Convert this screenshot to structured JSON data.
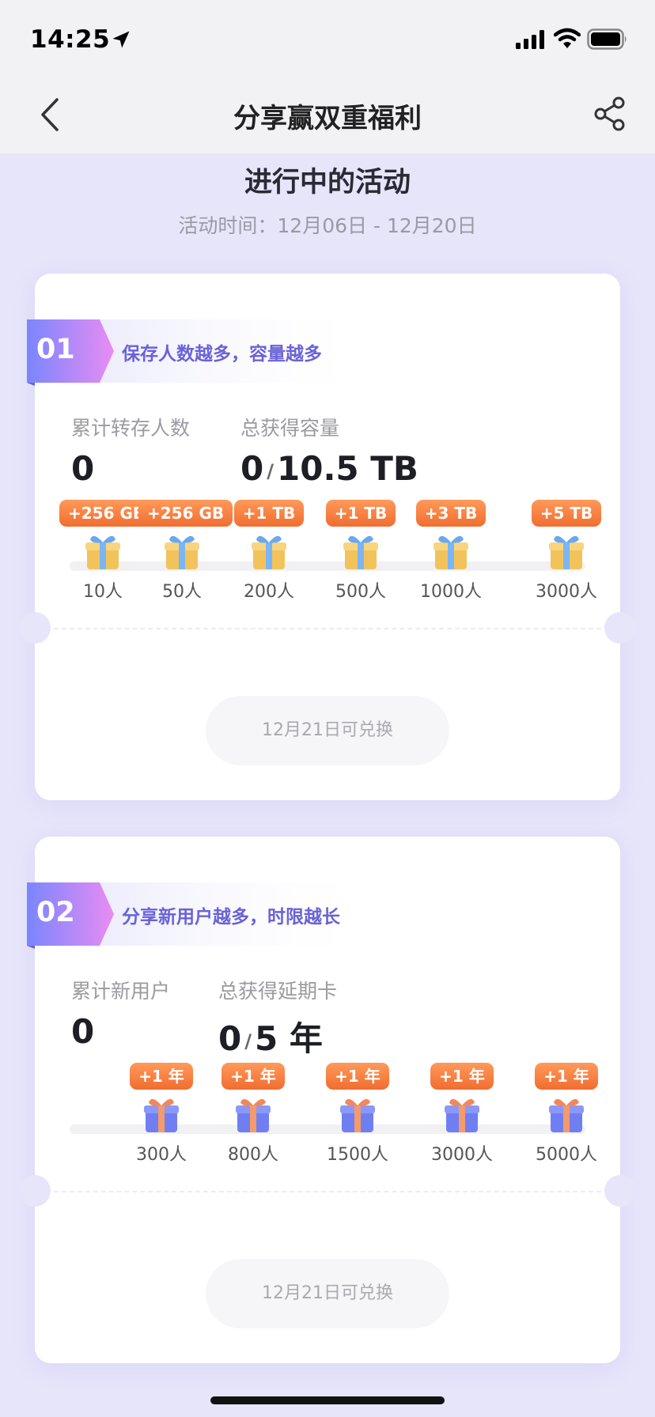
{
  "status_bar": {
    "time": "14:25"
  },
  "nav": {
    "title": "分享赢双重福利"
  },
  "section": {
    "title": "进行中的活动",
    "time_label": "活动时间：12月06日 - 12月20日"
  },
  "activities": [
    {
      "number": "01",
      "headline": "保存人数越多，容量越多",
      "stat_left_label": "累计转存人数",
      "stat_left_value": "0",
      "stat_right_label": "总获得容量",
      "stat_right_value": "0",
      "stat_right_total": "10.5 TB",
      "milestones": [
        {
          "reward": "+256 GB",
          "threshold": "10人"
        },
        {
          "reward": "+256 GB",
          "threshold": "50人"
        },
        {
          "reward": "+1 TB",
          "threshold": "200人"
        },
        {
          "reward": "+1 TB",
          "threshold": "500人"
        },
        {
          "reward": "+3 TB",
          "threshold": "1000人"
        },
        {
          "reward": "+5 TB",
          "threshold": "3000人"
        }
      ],
      "redeem_label": "12月21日可兑换"
    },
    {
      "number": "02",
      "headline": "分享新用户越多，时限越长",
      "stat_left_label": "累计新用户",
      "stat_left_value": "0",
      "stat_right_label": "总获得延期卡",
      "stat_right_value": "0",
      "stat_right_total": "5 年",
      "milestones": [
        {
          "reward": "+1 年",
          "threshold": "300人"
        },
        {
          "reward": "+1 年",
          "threshold": "800人"
        },
        {
          "reward": "+1 年",
          "threshold": "1500人"
        },
        {
          "reward": "+1 年",
          "threshold": "3000人"
        },
        {
          "reward": "+1 年",
          "threshold": "5000人"
        }
      ],
      "redeem_label": "12月21日可兑换"
    }
  ],
  "icons": {
    "location": "location-arrow-icon",
    "signal": "cellular-signal-icon",
    "wifi": "wifi-icon",
    "battery": "battery-icon",
    "back": "chevron-left-icon",
    "share": "share-icon",
    "gift_box_1": "gift-box-yellow-icon",
    "gift_box_2": "gift-box-blue-icon"
  },
  "colors": {
    "background": "#e6e5fa",
    "accent": "#6a62d8",
    "reward_pill": "#f06d30"
  }
}
